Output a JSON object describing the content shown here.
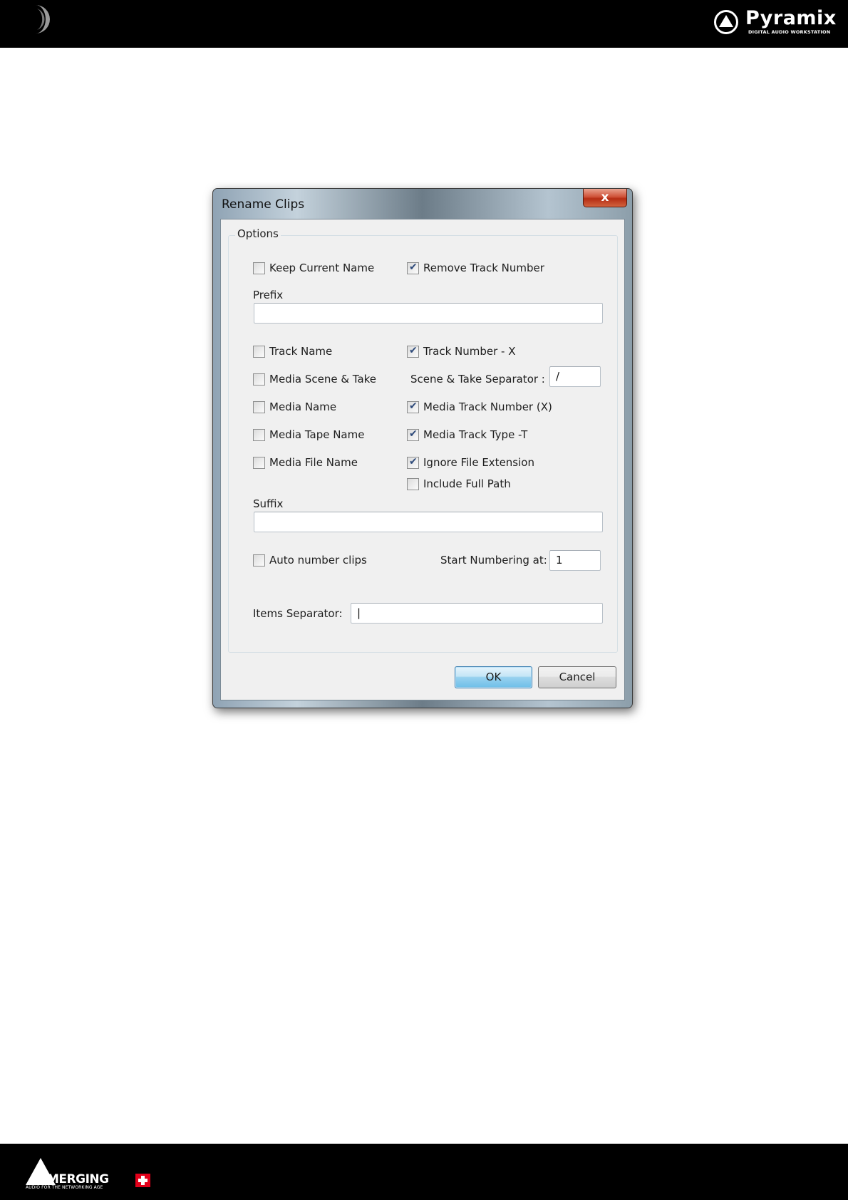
{
  "header": {
    "brand_name": "Pyramix",
    "brand_tagline": "DIGITAL AUDIO WORKSTATION"
  },
  "footer": {
    "brand_name": "MERGING",
    "brand_tagline": "AUDIO FOR THE NETWORKING AGE"
  },
  "dialog": {
    "title": "Rename Clips",
    "close_label": "x",
    "group_title": "Options",
    "options": {
      "keep_current_name": {
        "label": "Keep Current Name",
        "checked": false
      },
      "remove_track_number": {
        "label": "Remove Track Number",
        "checked": true
      },
      "track_name": {
        "label": "Track Name",
        "checked": false
      },
      "track_number_x": {
        "label": "Track Number - X",
        "checked": true
      },
      "media_scene_take": {
        "label": "Media Scene & Take",
        "checked": false
      },
      "media_name": {
        "label": "Media Name",
        "checked": false
      },
      "media_track_number": {
        "label": "Media Track Number (X)",
        "checked": true
      },
      "media_tape_name": {
        "label": "Media Tape Name",
        "checked": false
      },
      "media_track_type": {
        "label": "Media Track Type -T",
        "checked": true
      },
      "media_file_name": {
        "label": "Media File Name",
        "checked": false
      },
      "ignore_file_extension": {
        "label": "Ignore File Extension",
        "checked": true
      },
      "include_full_path": {
        "label": "Include Full Path",
        "checked": false
      },
      "auto_number_clips": {
        "label": "Auto number clips",
        "checked": false
      }
    },
    "prefix": {
      "label": "Prefix",
      "value": ""
    },
    "scene_take_separator": {
      "label": "Scene & Take Separator :",
      "value": "/"
    },
    "suffix": {
      "label": "Suffix",
      "value": ""
    },
    "start_numbering": {
      "label": "Start Numbering at:",
      "value": "1"
    },
    "items_separator": {
      "label": "Items Separator:",
      "value": "|"
    },
    "buttons": {
      "ok": "OK",
      "cancel": "Cancel"
    }
  },
  "colors": {
    "header_bg": "#000000",
    "dialog_face": "#f0f0f0",
    "check_mark": "#2e4a7a",
    "close_button": "#c43c22",
    "default_button": "#98d1ef",
    "swiss_red": "#e2001a"
  },
  "icons": {
    "moon": "moon-icon",
    "pyramix_logo": "pyramix-logo-icon",
    "merging_logo": "merging-logo-icon",
    "close": "close-icon",
    "checkbox": "checkbox-icon"
  }
}
